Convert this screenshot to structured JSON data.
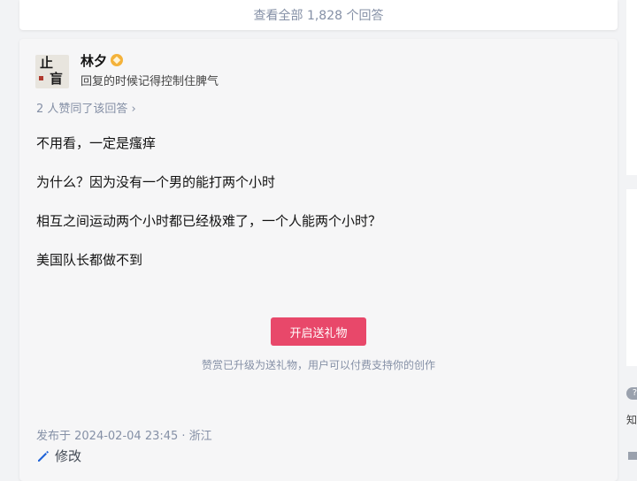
{
  "more_answers": {
    "label": "查看全部 1,828 个回答"
  },
  "answer": {
    "author": {
      "name": "林夕",
      "headline": "回复的时候记得控制住脾气",
      "avatar_chars": [
        "止",
        "盲"
      ]
    },
    "upvote_info": "2 人赞同了该回答 ›",
    "paragraphs": [
      "不用看，一定是瘙痒",
      "为什么？因为没有一个男的能打两个小时",
      "相互之间运动两个小时都已经极难了，一个人能两个小时？",
      "美国队长都做不到"
    ],
    "gift_button": "开启送礼物",
    "gift_note": "赞赏已升级为送礼物，用户可以付费支持你的创作",
    "publish_time": "发布于 2024-02-04 23:45 · 浙江",
    "edit_label": "修改"
  },
  "sidebar": {
    "help_text": "知"
  },
  "colors": {
    "accent": "#e8486a",
    "muted": "#8590a6",
    "badge": "#f4b23a"
  }
}
